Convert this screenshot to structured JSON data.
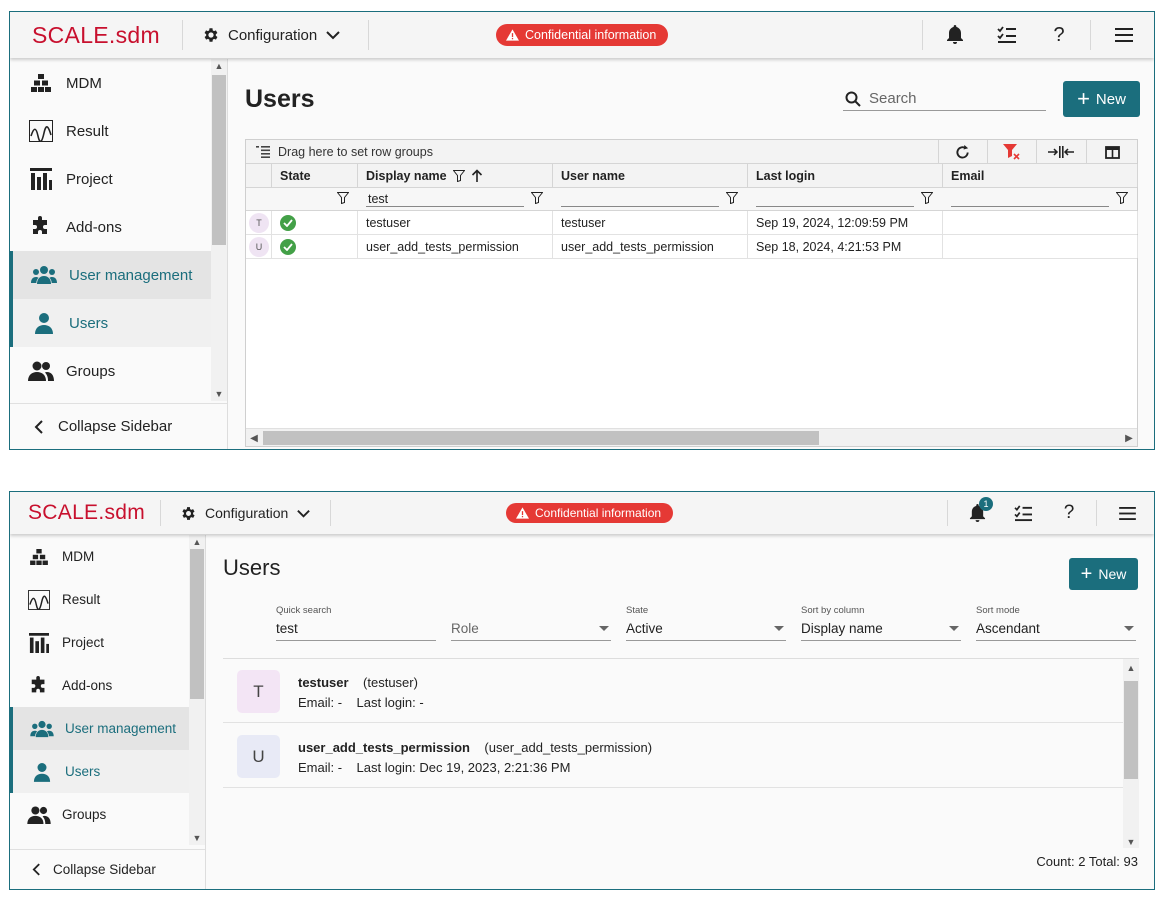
{
  "brand": "SCALE.sdm",
  "header": {
    "config_label": "Configuration",
    "confidential": "Confidential information",
    "notification_count": "1"
  },
  "sidebar": {
    "items": [
      {
        "label": "MDM",
        "icon": "hierarchy-icon"
      },
      {
        "label": "Result",
        "icon": "waveform-icon"
      },
      {
        "label": "Project",
        "icon": "bar-chart-icon"
      },
      {
        "label": "Add-ons",
        "icon": "puzzle-icon"
      },
      {
        "label": "User management",
        "icon": "user-group-icon"
      },
      {
        "label": "Users",
        "icon": "user-icon"
      },
      {
        "label": "Groups",
        "icon": "users-icon"
      }
    ],
    "collapse_label": "Collapse Sidebar"
  },
  "view1": {
    "title": "Users",
    "new_label": "New",
    "search_placeholder": "Search",
    "row_group_hint": "Drag here to set row groups",
    "columns": [
      "State",
      "Display name",
      "User name",
      "Last login",
      "Email"
    ],
    "display_name_filter": "test",
    "rows": [
      {
        "initial": "T",
        "display_name": "testuser",
        "user_name": "testuser",
        "last_login": "Sep 19, 2024, 12:09:59 PM",
        "email": ""
      },
      {
        "initial": "U",
        "display_name": "user_add_tests_permission",
        "user_name": "user_add_tests_permission",
        "last_login": "Sep 18, 2024, 4:21:53 PM",
        "email": ""
      }
    ]
  },
  "view2": {
    "title": "Users",
    "new_label": "New",
    "filters": {
      "quick_search_label": "Quick search",
      "quick_search_value": "test",
      "role_placeholder": "Role",
      "state_label": "State",
      "state_value": "Active",
      "sort_column_label": "Sort by column",
      "sort_column_value": "Display name",
      "sort_mode_label": "Sort mode",
      "sort_mode_value": "Ascendant"
    },
    "items": [
      {
        "initial": "T",
        "name": "testuser",
        "username": "(testuser)",
        "email": "Email: -",
        "last_login": "Last login: -",
        "avatar_color": "#f3e5f5"
      },
      {
        "initial": "U",
        "name": "user_add_tests_permission",
        "username": "(user_add_tests_permission)",
        "email": "Email: -",
        "last_login": "Last login: Dec 19, 2023, 2:21:36 PM",
        "avatar_color": "#e8eaf6"
      }
    ],
    "count_text": "Count: 2 Total: 93"
  },
  "colors": {
    "accent": "#1b6e7d",
    "brand": "#c8102e",
    "danger": "#e53935",
    "success": "#43a047"
  }
}
